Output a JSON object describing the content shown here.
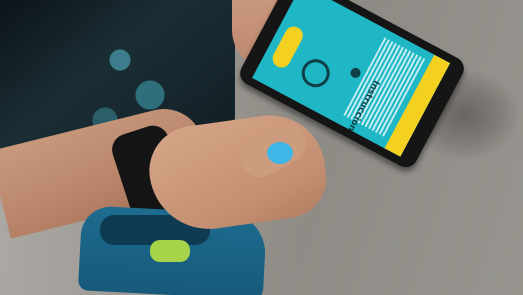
{
  "photo": {
    "subject": "Hand holding a smartphone over a pavement",
    "colors": {
      "screen": "#1fb7c6",
      "accent": "#f4d120",
      "nail_polish": "#3fb6e8",
      "bag": "#1d6c8f"
    }
  },
  "phone": {
    "screen_title": "Instrucciones de juego"
  }
}
